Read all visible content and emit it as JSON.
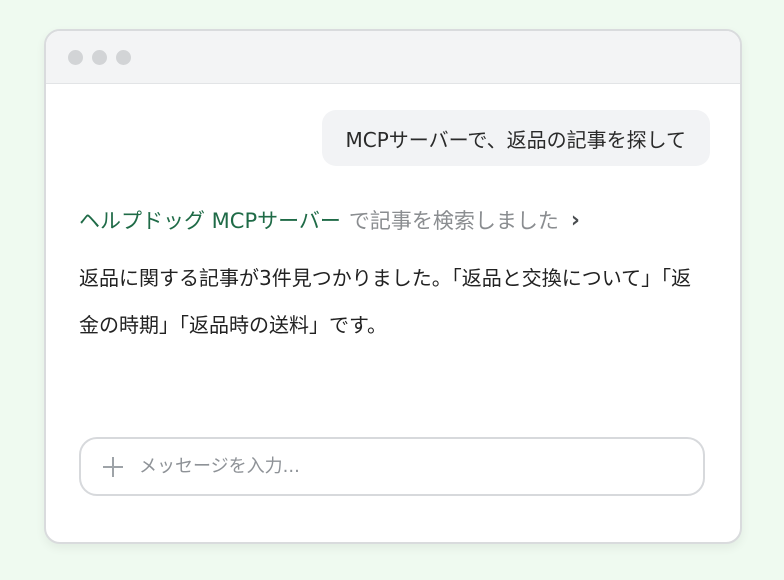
{
  "user_message": "MCPサーバーで、返品の記事を探して",
  "tool_call": {
    "server_name": "ヘルプドッグ MCPサーバー",
    "action_text": "で記事を検索しました",
    "chevron": "›"
  },
  "assistant_message": "返品に関する記事が3件見つかりました。「返品と交換について」「返金の時期」「返品時の送料」です。",
  "input": {
    "placeholder": "メッセージを入力...",
    "value": ""
  },
  "colors": {
    "background": "#effaf0",
    "link_green": "#1f6b47",
    "muted_gray": "#8a8d90"
  }
}
